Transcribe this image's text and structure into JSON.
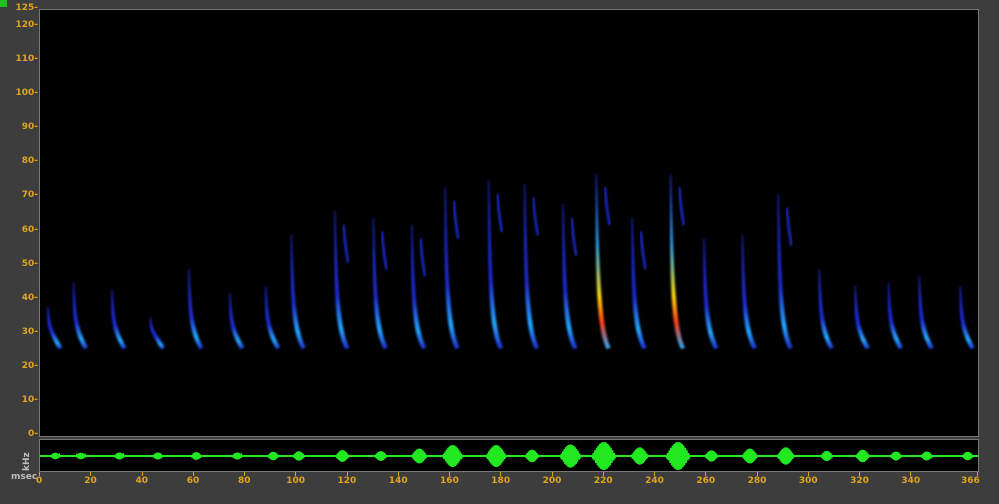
{
  "window": {
    "units": {
      "frequency": "kHz",
      "time": "msec"
    }
  },
  "spectrogram": {
    "y_axis": {
      "ticks": [
        "125-",
        "120-",
        "110-",
        "100-",
        "90-",
        "80-",
        "70-",
        "60-",
        "50-",
        "40-",
        "30-",
        "20-",
        "10-",
        "0-"
      ],
      "values": [
        125,
        120,
        110,
        100,
        90,
        80,
        70,
        60,
        50,
        40,
        30,
        20,
        10,
        0
      ],
      "min": 0,
      "max": 125
    },
    "calls": [
      {
        "t": 6,
        "fmax": 38
      },
      {
        "t": 16,
        "fmax": 45
      },
      {
        "t": 31,
        "fmax": 43
      },
      {
        "t": 46,
        "fmax": 35
      },
      {
        "t": 61,
        "fmax": 49
      },
      {
        "t": 77,
        "fmax": 42
      },
      {
        "t": 91,
        "fmax": 44
      },
      {
        "t": 101,
        "fmax": 59
      },
      {
        "t": 118,
        "fmax": 66
      },
      {
        "t": 133,
        "fmax": 64
      },
      {
        "t": 148,
        "fmax": 62
      },
      {
        "t": 161,
        "fmax": 73
      },
      {
        "t": 178,
        "fmax": 75
      },
      {
        "t": 192,
        "fmax": 74
      },
      {
        "t": 207,
        "fmax": 68
      },
      {
        "t": 220,
        "fmax": 77
      },
      {
        "t": 234,
        "fmax": 64
      },
      {
        "t": 249,
        "fmax": 77
      },
      {
        "t": 262,
        "fmax": 58
      },
      {
        "t": 277,
        "fmax": 59
      },
      {
        "t": 291,
        "fmax": 71
      },
      {
        "t": 307,
        "fmax": 49
      },
      {
        "t": 321,
        "fmax": 44
      },
      {
        "t": 334,
        "fmax": 45
      },
      {
        "t": 346,
        "fmax": 47
      },
      {
        "t": 362,
        "fmax": 44
      }
    ],
    "colors": {
      "background": "#000000",
      "low": "#1e2ad0",
      "mid": "#23a8ff",
      "high": "#ffd700",
      "peak": "#ff3b1c"
    }
  },
  "waveform": {
    "color": "#22e822",
    "bursts": [
      {
        "t": 6,
        "amp": 0.1
      },
      {
        "t": 16,
        "amp": 0.1
      },
      {
        "t": 31,
        "amp": 0.12
      },
      {
        "t": 46,
        "amp": 0.12
      },
      {
        "t": 61,
        "amp": 0.15
      },
      {
        "t": 77,
        "amp": 0.12
      },
      {
        "t": 91,
        "amp": 0.18
      },
      {
        "t": 101,
        "amp": 0.22
      },
      {
        "t": 118,
        "amp": 0.32
      },
      {
        "t": 133,
        "amp": 0.24
      },
      {
        "t": 148,
        "amp": 0.45
      },
      {
        "t": 161,
        "amp": 0.75
      },
      {
        "t": 178,
        "amp": 0.75
      },
      {
        "t": 192,
        "amp": 0.35
      },
      {
        "t": 207,
        "amp": 0.8
      },
      {
        "t": 220,
        "amp": 1.0
      },
      {
        "t": 234,
        "amp": 0.55
      },
      {
        "t": 249,
        "amp": 1.0
      },
      {
        "t": 262,
        "amp": 0.3
      },
      {
        "t": 277,
        "amp": 0.45
      },
      {
        "t": 291,
        "amp": 0.55
      },
      {
        "t": 307,
        "amp": 0.25
      },
      {
        "t": 321,
        "amp": 0.35
      },
      {
        "t": 334,
        "amp": 0.2
      },
      {
        "t": 346,
        "amp": 0.2
      },
      {
        "t": 362,
        "amp": 0.18
      }
    ]
  },
  "x_axis": {
    "ticks": [
      "0",
      "20",
      "40",
      "60",
      "80",
      "100",
      "120",
      "140",
      "160",
      "180",
      "200",
      "220",
      "240",
      "260",
      "280",
      "300",
      "320",
      "340",
      "366"
    ],
    "values": [
      0,
      20,
      40,
      60,
      80,
      100,
      120,
      140,
      160,
      180,
      200,
      220,
      240,
      260,
      280,
      300,
      320,
      340,
      366
    ],
    "min": 0,
    "max": 366
  }
}
